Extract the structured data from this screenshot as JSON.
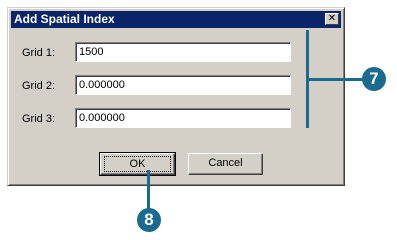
{
  "dialog": {
    "title": "Add Spatial Index",
    "close_glyph": "✕",
    "rows": [
      {
        "label": "Grid 1:",
        "value": "1500"
      },
      {
        "label": "Grid 2:",
        "value": "0.000000"
      },
      {
        "label": "Grid 3:",
        "value": "0.000000"
      }
    ],
    "ok_label": "OK",
    "cancel_label": "Cancel"
  },
  "callouts": {
    "grids_callout": "7",
    "ok_callout": "8"
  }
}
